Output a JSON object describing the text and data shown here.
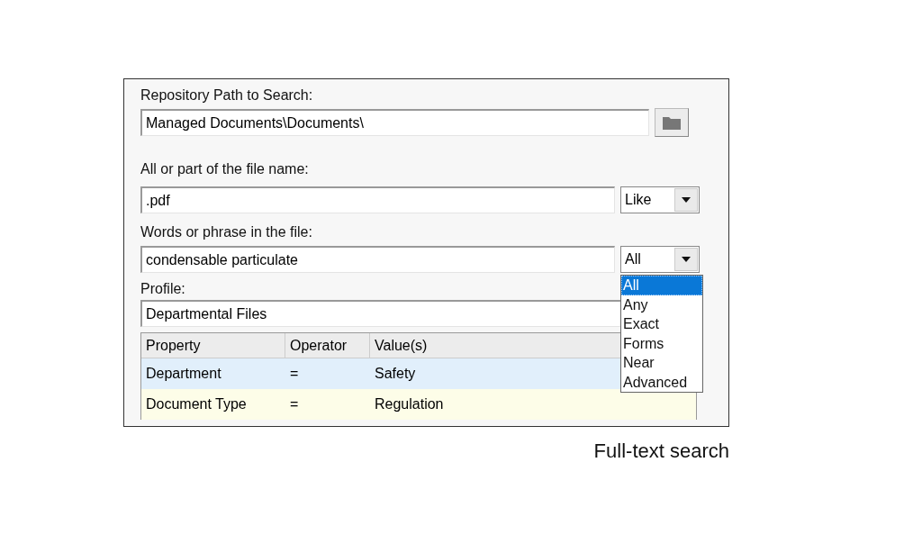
{
  "dialog": {
    "path": {
      "label": "Repository Path to Search:",
      "value": "Managed Documents\\Documents\\"
    },
    "file_name": {
      "label": "All or part of the file name:",
      "value": ".pdf",
      "mode": {
        "value": "Like"
      }
    },
    "words": {
      "label": "Words or phrase in the file:",
      "value": "condensable particulate",
      "mode": {
        "value": "All",
        "expanded": true,
        "options": [
          {
            "label": "All",
            "selected": true
          },
          {
            "label": "Any",
            "selected": false
          },
          {
            "label": "Exact",
            "selected": false
          },
          {
            "label": "Forms",
            "selected": false
          },
          {
            "label": "Near",
            "selected": false
          },
          {
            "label": "Advanced",
            "selected": false
          }
        ]
      }
    },
    "profile": {
      "label": "Profile:",
      "value": "Departmental Files"
    },
    "table": {
      "columns": [
        "Property",
        "Operator",
        "Value(s)"
      ],
      "rows": [
        {
          "cells": [
            "Department",
            "=",
            "Safety"
          ],
          "selected": true
        },
        {
          "cells": [
            "Document Type",
            "=",
            "Regulation"
          ],
          "selected": false
        }
      ]
    }
  },
  "caption": "Full-text search"
}
